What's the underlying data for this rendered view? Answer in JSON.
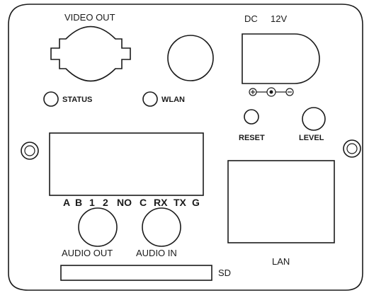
{
  "labels": {
    "video_out": "VIDEO OUT",
    "dc": "DC",
    "dc_voltage": "12V",
    "status": "STATUS",
    "wlan": "WLAN",
    "reset": "RESET",
    "level": "LEVEL",
    "audio_out": "AUDIO OUT",
    "audio_in": "AUDIO IN",
    "lan": "LAN",
    "sd": "SD"
  },
  "terminal_labels": [
    "A",
    "B",
    "1",
    "2",
    "NO",
    "C",
    "RX",
    "TX",
    "G"
  ]
}
